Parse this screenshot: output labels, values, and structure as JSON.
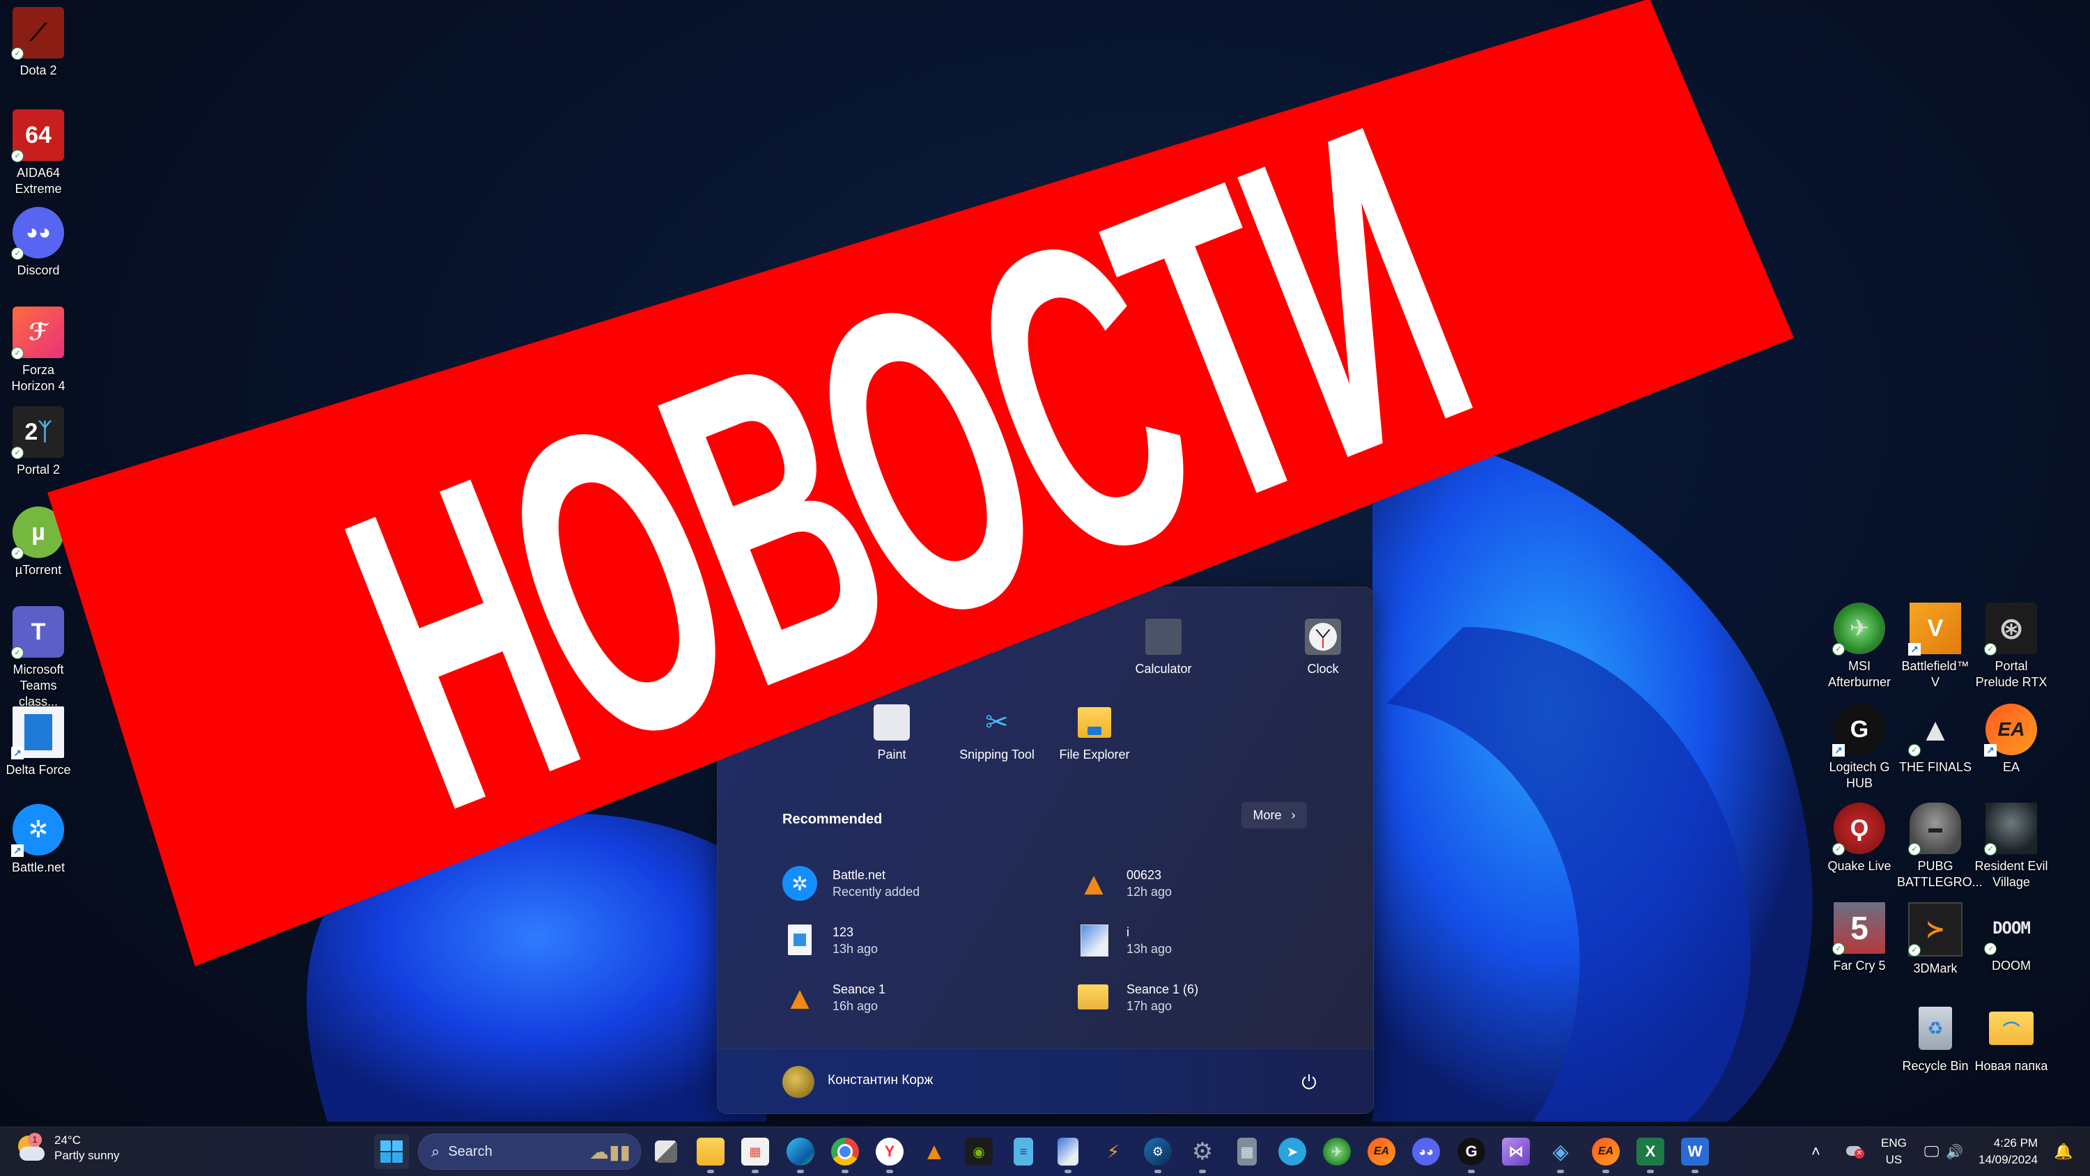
{
  "banner": {
    "text": "НОВОСТИ",
    "background_color": "#ff0000",
    "text_color": "#ffffff"
  },
  "desktop": {
    "left_icons": [
      {
        "label": "Dota 2",
        "icon": "dota2-icon",
        "badge": "sync"
      },
      {
        "label": "AIDA64 Extreme",
        "icon": "aida64-icon",
        "badge": "sync"
      },
      {
        "label": "Discord",
        "icon": "discord-icon",
        "badge": "sync"
      },
      {
        "label": "Forza Horizon 4",
        "icon": "forza-icon",
        "badge": "sync"
      },
      {
        "label": "Portal 2",
        "icon": "portal2-icon",
        "badge": "sync"
      },
      {
        "label": "µTorrent",
        "icon": "utorrent-icon",
        "badge": "sync"
      },
      {
        "label": "Microsoft Teams class...",
        "icon": "teams-icon",
        "badge": "sync"
      },
      {
        "label": "Delta Force",
        "icon": "delta-force-icon",
        "badge": "shortcut"
      },
      {
        "label": "Battle.net",
        "icon": "battlenet-icon",
        "badge": "shortcut"
      }
    ],
    "right_icons": [
      {
        "label": "MSI Afterburner",
        "icon": "msi-afterburner-icon",
        "badge": "sync"
      },
      {
        "label": "Battlefield™ V",
        "icon": "battlefield-icon",
        "badge": "shortcut"
      },
      {
        "label": "Portal Prelude RTX",
        "icon": "portal-prelude-icon",
        "badge": "sync"
      },
      {
        "label": "Logitech G HUB",
        "icon": "logitech-icon",
        "badge": "shortcut"
      },
      {
        "label": "THE FINALS",
        "icon": "the-finals-icon",
        "badge": "sync"
      },
      {
        "label": "EA",
        "icon": "ea-icon",
        "badge": "shortcut"
      },
      {
        "label": "Quake Live",
        "icon": "quake-icon",
        "badge": "sync"
      },
      {
        "label": "PUBG BATTLEGRO...",
        "icon": "pubg-icon",
        "badge": "sync"
      },
      {
        "label": "Resident Evil Village",
        "icon": "re-village-icon",
        "badge": "sync"
      },
      {
        "label": "Far Cry 5",
        "icon": "farcry5-icon",
        "badge": "sync"
      },
      {
        "label": "3DMark",
        "icon": "3dmark-icon",
        "badge": "sync"
      },
      {
        "label": "DOOM",
        "icon": "doom-icon",
        "badge": "sync"
      },
      {
        "label": "Recycle Bin",
        "icon": "recycle-bin-icon",
        "badge": ""
      },
      {
        "label": "Новая папка",
        "icon": "folder-icon",
        "badge": ""
      }
    ]
  },
  "start_menu": {
    "pinned": [
      {
        "label": "Calculator",
        "icon": "calculator-icon"
      },
      {
        "label": "Clock",
        "icon": "clock-icon"
      },
      {
        "label": "Paint",
        "icon": "paint-icon"
      },
      {
        "label": "Snipping Tool",
        "icon": "snipping-tool-icon"
      },
      {
        "label": "File Explorer",
        "icon": "file-explorer-icon"
      }
    ],
    "recommended_title": "Recommended",
    "more_label": "More",
    "recommended": [
      {
        "name": "Battle.net",
        "sub": "Recently added",
        "icon": "battlenet-icon"
      },
      {
        "name": "00623",
        "sub": "12h ago",
        "icon": "vlc-icon"
      },
      {
        "name": "123",
        "sub": "13h ago",
        "icon": "image-file-icon"
      },
      {
        "name": "i",
        "sub": "13h ago",
        "icon": "paint-file-icon"
      },
      {
        "name": "Seance 1",
        "sub": "16h ago",
        "icon": "vlc-icon"
      },
      {
        "name": "Seance 1 (6)",
        "sub": "17h ago",
        "icon": "zip-folder-icon"
      }
    ],
    "user_name": "Константин Корж"
  },
  "taskbar": {
    "weather": {
      "temp": "24°C",
      "condition": "Partly sunny",
      "badge": "1"
    },
    "search_placeholder": "Search",
    "apps": [
      {
        "name": "task-view",
        "glyph": ""
      },
      {
        "name": "file-explorer",
        "glyph": ""
      },
      {
        "name": "microsoft-store",
        "glyph": ""
      },
      {
        "name": "edge",
        "glyph": ""
      },
      {
        "name": "chrome",
        "glyph": ""
      },
      {
        "name": "yandex",
        "glyph": "Y"
      },
      {
        "name": "vlc",
        "glyph": ""
      },
      {
        "name": "nvidia",
        "glyph": ""
      },
      {
        "name": "notepad",
        "glyph": ""
      },
      {
        "name": "paint",
        "glyph": ""
      },
      {
        "name": "winamp",
        "glyph": ""
      },
      {
        "name": "steam",
        "glyph": ""
      },
      {
        "name": "settings",
        "glyph": ""
      },
      {
        "name": "calculator",
        "glyph": ""
      },
      {
        "name": "telegram",
        "glyph": ""
      },
      {
        "name": "msi-afterburner",
        "glyph": ""
      },
      {
        "name": "ea",
        "glyph": "EA"
      },
      {
        "name": "discord",
        "glyph": ""
      },
      {
        "name": "logitech",
        "glyph": "G"
      },
      {
        "name": "visual-studio",
        "glyph": ""
      },
      {
        "name": "network-tool",
        "glyph": ""
      },
      {
        "name": "ea-2",
        "glyph": "EA"
      },
      {
        "name": "excel",
        "glyph": "X"
      },
      {
        "name": "word",
        "glyph": "W"
      }
    ],
    "lang_top": "ENG",
    "lang_bottom": "US",
    "time": "4:26 PM",
    "date": "14/09/2024"
  }
}
